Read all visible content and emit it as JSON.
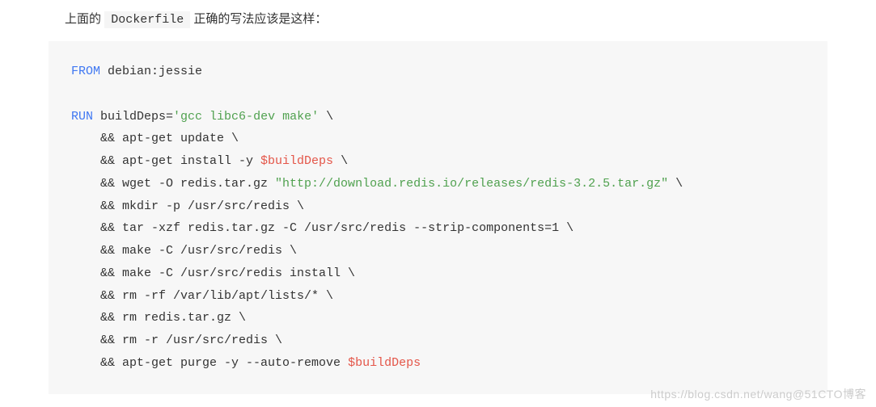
{
  "intro": {
    "before": "上面的",
    "code": "Dockerfile",
    "after": "正确的写法应该是这样："
  },
  "code": {
    "kw_from": "FROM",
    "from_image": " debian:jessie",
    "kw_run": "RUN",
    "line1_a": " buildDeps=",
    "line1_str": "'gcc libc6-dev make'",
    "line1_b": " \\",
    "line2": "    && apt-get update \\",
    "line3_a": "    && apt-get install -y ",
    "line3_var": "$buildDeps",
    "line3_b": " \\",
    "line4_a": "    && wget -O redis.tar.gz ",
    "line4_str": "\"http://download.redis.io/releases/redis-3.2.5.tar.gz\"",
    "line4_b": " \\",
    "line5": "    && mkdir -p /usr/src/redis \\",
    "line6": "    && tar -xzf redis.tar.gz -C /usr/src/redis --strip-components=1 \\",
    "line7": "    && make -C /usr/src/redis \\",
    "line8": "    && make -C /usr/src/redis install \\",
    "line9": "    && rm -rf /var/lib/apt/lists/* \\",
    "line10": "    && rm redis.tar.gz \\",
    "line11": "    && rm -r /usr/src/redis \\",
    "line12_a": "    && apt-get purge -y --auto-remove ",
    "line12_var": "$buildDeps"
  },
  "watermark": "https://blog.csdn.net/wang@51CTO博客"
}
